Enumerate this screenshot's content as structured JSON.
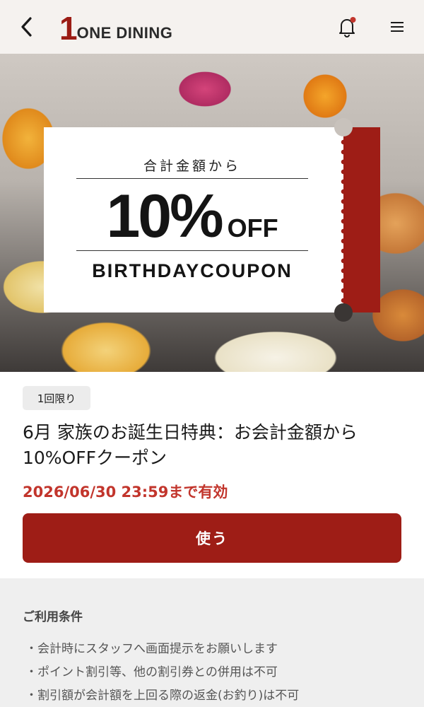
{
  "header": {
    "logo_mark": "1",
    "logo_text": "ONE DINING",
    "back_icon": "chevron-left-icon",
    "notification_icon": "bell-icon",
    "notification_dot_color": "#c2352c",
    "menu_icon": "hamburger-menu-icon"
  },
  "hero": {
    "coupon": {
      "subtitle": "合計金額から",
      "discount": "10%",
      "off_label": "OFF",
      "type_label": "BIRTHDAYCOUPON"
    }
  },
  "details": {
    "badge": "1回限り",
    "title": "6月 家族のお誕生日特典：お会計金額から10%OFFクーポン",
    "expiry": "2026/06/30 23:59まで有効",
    "use_button": "使う"
  },
  "terms": {
    "heading": "ご利用条件",
    "items": [
      "会計時にスタッフへ画面提示をお願いします",
      "ポイント割引等、他の割引券との併用は不可",
      "割引額が会計額を上回る際の返金(お釣り)は不可"
    ]
  },
  "colors": {
    "brand_red": "#9e1d16",
    "expiry_red": "#c2352c",
    "header_bg": "#f5f2ef",
    "terms_bg": "#efefef"
  }
}
